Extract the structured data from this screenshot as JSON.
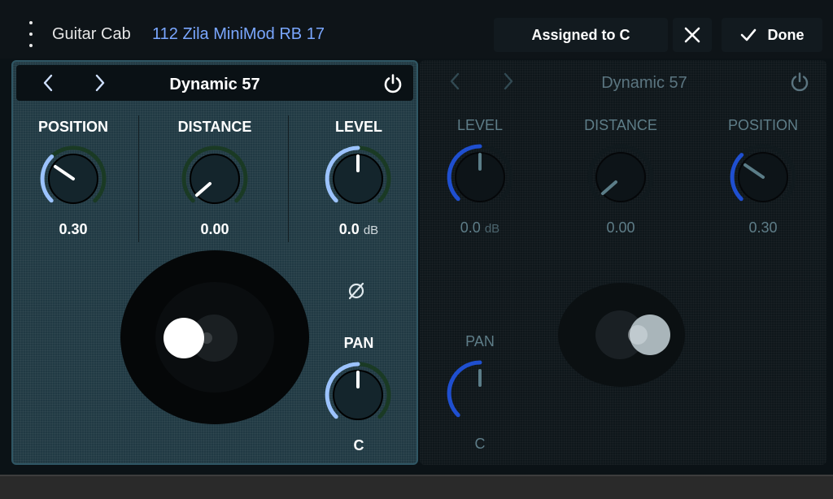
{
  "header": {
    "instrument_type": "Guitar Cab",
    "preset_name": "112 Zila MiniMod RB 17",
    "assigned_label": "Assigned to C",
    "done_label": "Done"
  },
  "mic_a": {
    "mic_name": "Dynamic 57",
    "active": true,
    "position": {
      "label": "POSITION",
      "value": "0.30"
    },
    "distance": {
      "label": "DISTANCE",
      "value": "0.00"
    },
    "level": {
      "label": "LEVEL",
      "value": "0.0",
      "unit": "dB"
    },
    "pan": {
      "label": "PAN",
      "value": "C"
    }
  },
  "mic_b": {
    "mic_name": "Dynamic 57",
    "active": false,
    "level": {
      "label": "LEVEL",
      "value": "0.0",
      "unit": "dB"
    },
    "distance": {
      "label": "DISTANCE",
      "value": "0.00"
    },
    "position": {
      "label": "POSITION",
      "value": "0.30"
    },
    "pan": {
      "label": "PAN",
      "value": "C"
    }
  },
  "colors": {
    "accent_blue": "#7aa7ff",
    "active_arc": "#9cc3ff",
    "inactive_arc": "#1f4fd0",
    "active_panel": "#213a44"
  },
  "icons": [
    "kebab-menu-icon",
    "close-icon",
    "checkmark-icon",
    "chevron-left-icon",
    "chevron-right-icon",
    "power-icon",
    "phase-invert-icon"
  ]
}
